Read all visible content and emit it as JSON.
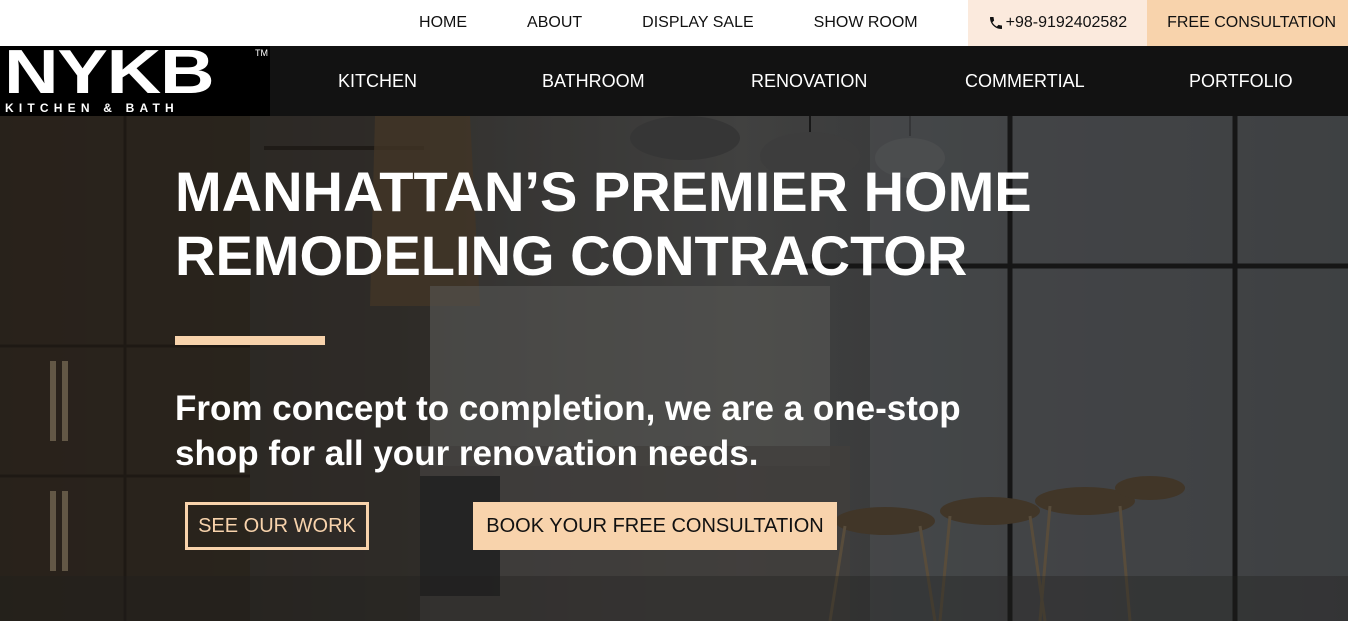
{
  "topbar": {
    "links": [
      "HOME",
      "ABOUT",
      "DISPLAY SALE",
      "SHOW ROOM"
    ],
    "phone": "+98-9192402582",
    "phone_icon": "phone-icon",
    "cta": "FREE CONSULTATION"
  },
  "logo": {
    "main": "NYKB",
    "tm": "TM",
    "sub": "KITCHEN & BATH"
  },
  "nav": {
    "items": [
      "KITCHEN",
      "BATHROOM",
      "RENOVATION",
      "COMMERTIAL",
      "PORTFOLIO"
    ]
  },
  "hero": {
    "title_line1": "MANHATTAN’S PREMIER HOME",
    "title_line2": "REMODELING CONTRACTOR",
    "subtitle_line1": "From concept to completion, we are a one-stop",
    "subtitle_line2": "shop for all your renovation needs.",
    "button_outline": "SEE OUR WORK",
    "button_fill": "BOOK YOUR FREE CONSULTATION"
  },
  "colors": {
    "accent": "#f8d3ac",
    "phone_bg": "#fbeadd",
    "nav_bg": "#121212"
  }
}
